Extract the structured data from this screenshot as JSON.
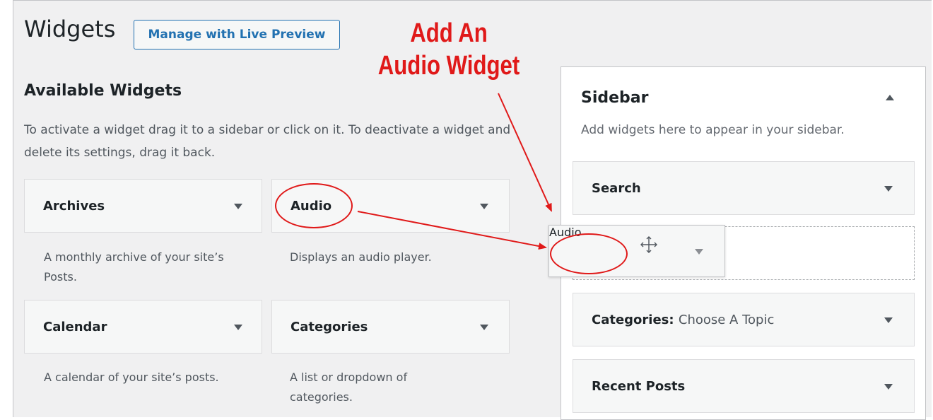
{
  "header": {
    "title": "Widgets",
    "live_preview_label": "Manage with Live Preview"
  },
  "available": {
    "title": "Available Widgets",
    "description": "To activate a widget drag it to a sidebar or click on it. To deactivate a widget and delete its settings, drag it back.",
    "widgets": [
      {
        "name": "Archives",
        "description": "A monthly archive of your site’s Posts."
      },
      {
        "name": "Audio",
        "description": "Displays an audio player."
      },
      {
        "name": "Calendar",
        "description": "A calendar of your site’s posts."
      },
      {
        "name": "Categories",
        "description": "A list or dropdown of categories."
      }
    ]
  },
  "sidebar": {
    "title": "Sidebar",
    "description": "Add widgets here to appear in your sidebar.",
    "widgets": [
      {
        "name": "Search",
        "subtitle": ""
      },
      {
        "name": "Categories:",
        "subtitle": "Choose A Topic"
      },
      {
        "name": "Recent Posts",
        "subtitle": ""
      }
    ],
    "dragging_widget": "Audio"
  },
  "annotation": {
    "line1": "Add An",
    "line2": "Audio Widget",
    "color": "#e01919"
  },
  "icons": {
    "caret": "chevron-down-icon",
    "collapse": "chevron-up-icon",
    "move": "move-icon"
  }
}
